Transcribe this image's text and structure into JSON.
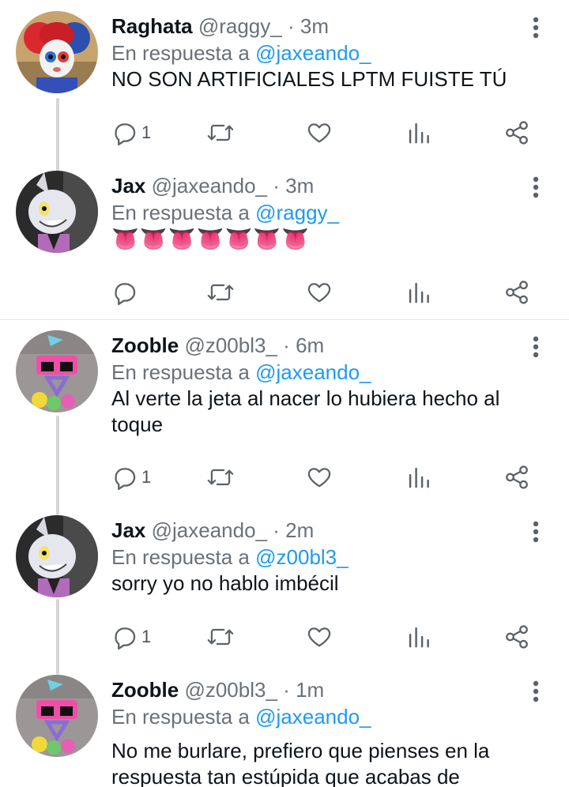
{
  "colors": {
    "mention": "#1d9bf0",
    "muted": "#6a7178",
    "icon": "#5b6167"
  },
  "labels": {
    "in_reply_to": "En respuesta a"
  },
  "tweets": [
    {
      "name": "Raghata",
      "handle": "@raggy_",
      "sep": "·",
      "time": "3m",
      "reply_to": "@jaxeando_",
      "text": "NO SON ARTIFICIALES LPTM FUISTE TÚ",
      "reply_count": "1",
      "avatar": "pomni-avatar"
    },
    {
      "name": "Jax",
      "handle": "@jaxeando_",
      "sep": "·",
      "time": "3m",
      "reply_to": "@raggy_",
      "text": "👅👅👅👅👅👅👅",
      "reply_count": "",
      "avatar": "jax-avatar"
    },
    {
      "name": "Zooble",
      "handle": "@z00bl3_",
      "sep": "·",
      "time": "6m",
      "reply_to": "@jaxeando_",
      "text": "Al verte la jeta al nacer lo hubiera hecho al toque",
      "reply_count": "1",
      "avatar": "zooble-avatar"
    },
    {
      "name": "Jax",
      "handle": "@jaxeando_",
      "sep": "·",
      "time": "2m",
      "reply_to": "@z00bl3_",
      "text": "sorry yo no hablo imbécil",
      "reply_count": "1",
      "avatar": "jax-avatar"
    },
    {
      "name": "Zooble",
      "handle": "@z00bl3_",
      "sep": "·",
      "time": "1m",
      "reply_to": "@jaxeando_",
      "text": "No me burlare, prefiero que pienses en la respuesta tan estúpida que acabas de",
      "reply_count": "",
      "avatar": "zooble-avatar"
    }
  ]
}
